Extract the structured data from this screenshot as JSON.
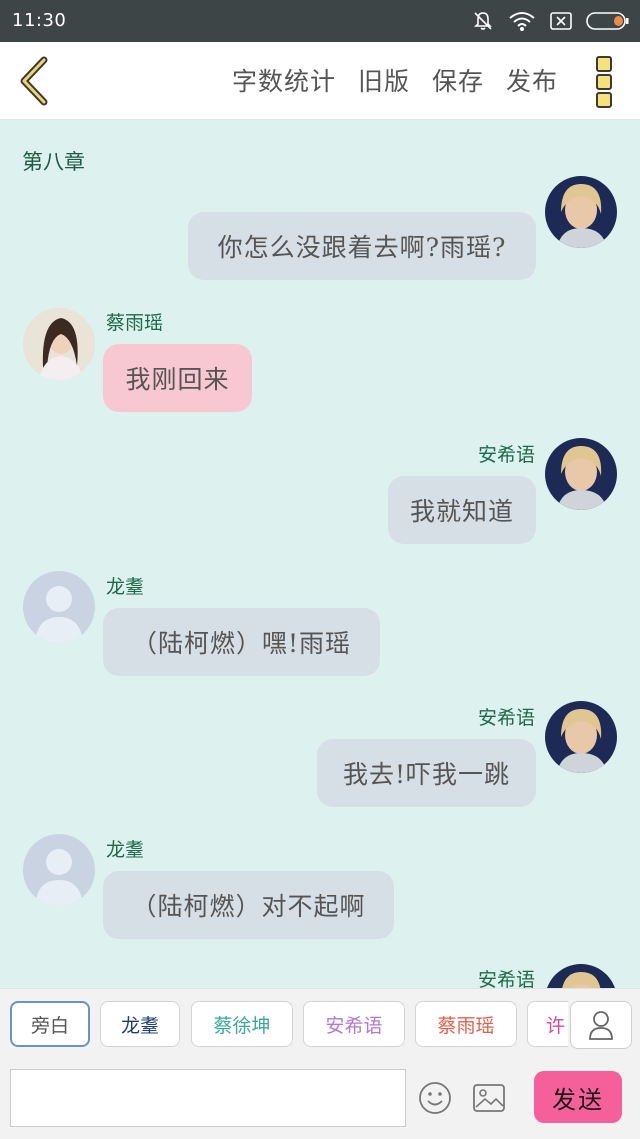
{
  "status_bar": {
    "time": "11:30"
  },
  "toolbar": {
    "back_label": "",
    "actions": [
      "字数统计",
      "旧版",
      "保存",
      "发布"
    ]
  },
  "chapter": "第八章",
  "messages": [
    {
      "side": "right",
      "name": "",
      "text": "你怎么没跟着去啊?雨瑶?",
      "avatar": "photo-blonde"
    },
    {
      "side": "left",
      "name": "蔡雨瑶",
      "text": "我刚回来",
      "avatar": "photo-brunette",
      "bubble_color": "#f8c8d2"
    },
    {
      "side": "right",
      "name": "安希语",
      "text": "我就知道",
      "avatar": "photo-blonde"
    },
    {
      "side": "left",
      "name": "龙耋",
      "text": "（陆柯燃）嘿!雨瑶",
      "avatar": "default-person"
    },
    {
      "side": "right",
      "name": "安希语",
      "text": "我去!吓我一跳",
      "avatar": "photo-blonde"
    },
    {
      "side": "left",
      "name": "龙耋",
      "text": "（陆柯燃）对不起啊",
      "avatar": "default-person"
    },
    {
      "side": "right",
      "name": "安希语",
      "text": "",
      "avatar": "photo-blonde"
    }
  ],
  "roles": [
    {
      "label": "旁白",
      "color": "#555555",
      "selected": true
    },
    {
      "label": "龙耋",
      "color": "#1f3f7a"
    },
    {
      "label": "蔡徐坤",
      "color": "#3aa89a"
    },
    {
      "label": "安希语",
      "color": "#b07ad0"
    },
    {
      "label": "蔡雨瑶",
      "color": "#e0604a"
    },
    {
      "label": "许",
      "color": "#d04a9a"
    }
  ],
  "input": {
    "value": "",
    "placeholder": ""
  },
  "send_label": "发送",
  "colors": {
    "chat_bg": "#ddf1ee",
    "bubble": "#d6dfe6",
    "send": "#f5609a",
    "name": "#1e6a4a",
    "status_bar": "#3d4546"
  },
  "icons": [
    "mute-icon",
    "wifi-icon",
    "sim-icon",
    "battery-icon",
    "back-chevron-icon",
    "more-icon",
    "emoji-icon",
    "image-icon",
    "person-icon"
  ]
}
